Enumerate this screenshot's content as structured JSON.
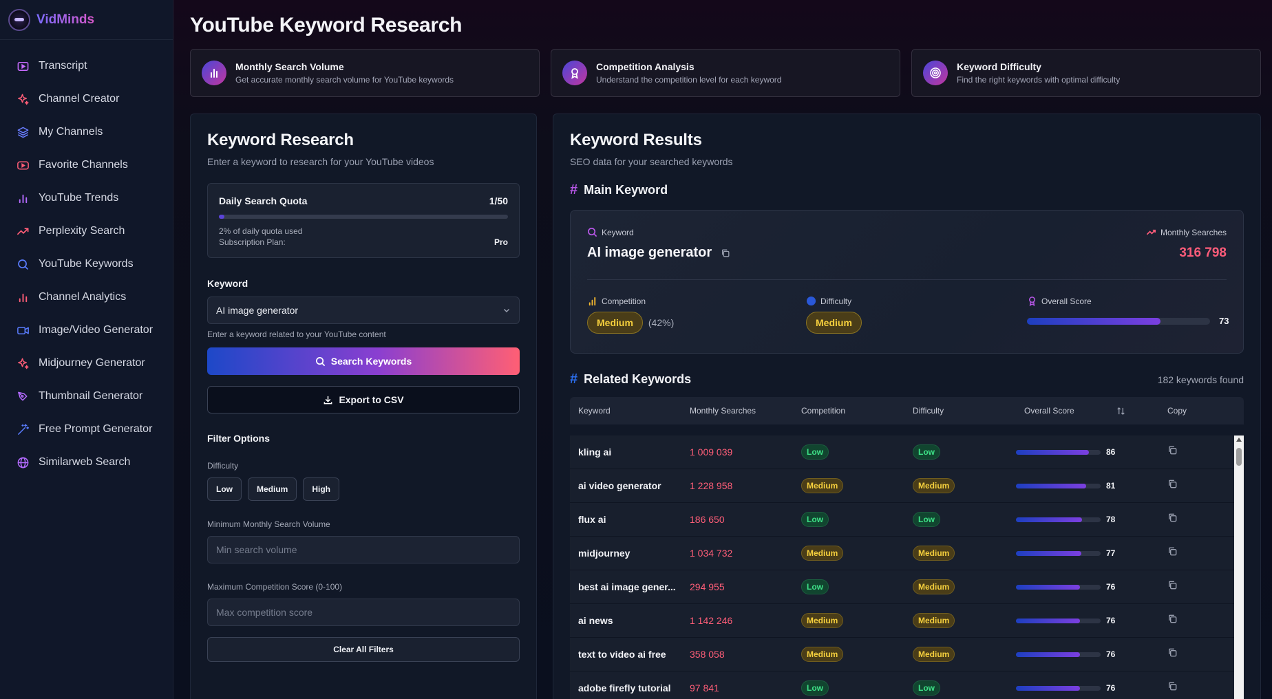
{
  "brand": {
    "name": "VidMinds"
  },
  "sidebar": {
    "items": [
      {
        "label": "Transcript",
        "icon": "video-icon",
        "color": "#c86bff"
      },
      {
        "label": "Channel Creator",
        "icon": "sparkles-icon",
        "color": "#ff5d77"
      },
      {
        "label": "My Channels",
        "icon": "layers-icon",
        "color": "#6a7dff"
      },
      {
        "label": "Favorite Channels",
        "icon": "youtube-icon",
        "color": "#ff5d77"
      },
      {
        "label": "YouTube Trends",
        "icon": "bar-chart-icon",
        "color": "#b46bff"
      },
      {
        "label": "Perplexity Search",
        "icon": "trending-icon",
        "color": "#ff5d77"
      },
      {
        "label": "YouTube Keywords",
        "icon": "search-icon",
        "color": "#5a7dff"
      },
      {
        "label": "Channel Analytics",
        "icon": "bar-chart-icon",
        "color": "#ff5d77"
      },
      {
        "label": "Image/Video Generator",
        "icon": "camera-icon",
        "color": "#5a7dff"
      },
      {
        "label": "Midjourney Generator",
        "icon": "sparkles-icon",
        "color": "#ff5d77"
      },
      {
        "label": "Thumbnail Generator",
        "icon": "brush-icon",
        "color": "#b46bff"
      },
      {
        "label": "Free Prompt Generator",
        "icon": "wand-icon",
        "color": "#5a7dff"
      },
      {
        "label": "Similarweb Search",
        "icon": "globe-icon",
        "color": "#b46bff"
      }
    ]
  },
  "page": {
    "title": "YouTube Keyword Research"
  },
  "features": [
    {
      "title": "Monthly Search Volume",
      "sub": "Get accurate monthly search volume for YouTube keywords",
      "icon": "bar-chart-icon"
    },
    {
      "title": "Competition Analysis",
      "sub": "Understand the competition level for each keyword",
      "icon": "award-icon"
    },
    {
      "title": "Keyword Difficulty",
      "sub": "Find the right keywords with optimal difficulty",
      "icon": "target-icon"
    }
  ],
  "research": {
    "title": "Keyword Research",
    "sub": "Enter a keyword to research for your YouTube videos",
    "quota_label": "Daily Search Quota",
    "quota_value": "1/50",
    "quota_used_fraction": 0.02,
    "quota_used_text": "2% of daily quota used",
    "plan_label": "Subscription Plan:",
    "plan_value": "Pro",
    "keyword_label": "Keyword",
    "keyword_value": "AI image generator",
    "keyword_hint": "Enter a keyword related to your YouTube content",
    "search_button": "Search Keywords",
    "export_button": "Export to CSV",
    "filter_title": "Filter Options",
    "difficulty_label": "Difficulty",
    "difficulty_options": [
      "Low",
      "Medium",
      "High"
    ],
    "min_volume_label": "Minimum Monthly Search Volume",
    "min_volume_placeholder": "Min search volume",
    "max_comp_label": "Maximum Competition Score (0-100)",
    "max_comp_placeholder": "Max competition score",
    "clear_button": "Clear All Filters"
  },
  "results": {
    "title": "Keyword Results",
    "sub": "SEO data for your searched keywords",
    "main_heading": "Main Keyword",
    "main": {
      "keyword_label": "Keyword",
      "keyword": "AI image generator",
      "searches_label": "Monthly Searches",
      "searches": "316 798",
      "competition_label": "Competition",
      "competition": "Medium",
      "competition_pct": "(42%)",
      "difficulty_label": "Difficulty",
      "difficulty": "Medium",
      "score_label": "Overall Score",
      "score": "73",
      "score_fraction": 0.73
    },
    "related_heading": "Related Keywords",
    "found": "182 keywords found",
    "columns": [
      "Keyword",
      "Monthly Searches",
      "Competition",
      "Difficulty",
      "Overall Score",
      "Copy"
    ],
    "rows": [
      {
        "keyword": "kling ai",
        "searches": "1 009 039",
        "competition": "Low",
        "difficulty": "Low",
        "score": "86",
        "score_fraction": 0.86
      },
      {
        "keyword": "ai video generator",
        "searches": "1 228 958",
        "competition": "Medium",
        "difficulty": "Medium",
        "score": "81",
        "score_fraction": 0.83
      },
      {
        "keyword": "flux ai",
        "searches": "186 650",
        "competition": "Low",
        "difficulty": "Low",
        "score": "78",
        "score_fraction": 0.78
      },
      {
        "keyword": "midjourney",
        "searches": "1 034 732",
        "competition": "Medium",
        "difficulty": "Medium",
        "score": "77",
        "score_fraction": 0.77
      },
      {
        "keyword": "best ai image gener...",
        "searches": "294 955",
        "competition": "Low",
        "difficulty": "Medium",
        "score": "76",
        "score_fraction": 0.76
      },
      {
        "keyword": "ai news",
        "searches": "1 142 246",
        "competition": "Medium",
        "difficulty": "Medium",
        "score": "76",
        "score_fraction": 0.76
      },
      {
        "keyword": "text to video ai free",
        "searches": "358 058",
        "competition": "Medium",
        "difficulty": "Medium",
        "score": "76",
        "score_fraction": 0.76
      },
      {
        "keyword": "adobe firefly tutorial",
        "searches": "97 841",
        "competition": "Low",
        "difficulty": "Low",
        "score": "76",
        "score_fraction": 0.76
      }
    ]
  }
}
